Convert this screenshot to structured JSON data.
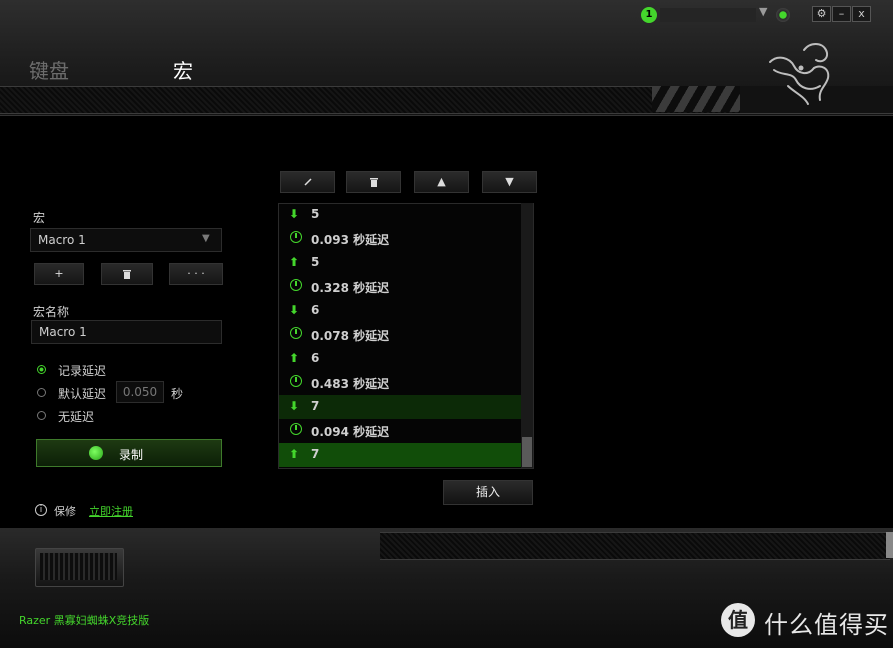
{
  "header": {
    "tabs": [
      {
        "label": "键盘"
      },
      {
        "label": "宏"
      }
    ],
    "user_badge": "1",
    "window_buttons": {
      "settings": "⚙",
      "minimize": "–",
      "close": "x"
    }
  },
  "left_panel": {
    "macro_label": "宏",
    "macro_select_value": "Macro 1",
    "buttons": {
      "add": "+",
      "delete": "🗑",
      "more": "· · ·"
    },
    "macro_name_label": "宏名称",
    "macro_name_value": "Macro 1",
    "delay_options": [
      {
        "label": "记录延迟",
        "selected": true
      },
      {
        "label": "默认延迟",
        "selected": false
      },
      {
        "label": "无延迟",
        "selected": false
      }
    ],
    "default_delay_value": "0.050",
    "default_delay_unit": "秒",
    "record_label": "录制",
    "hint_label": "保修",
    "register_link": "立即注册"
  },
  "right_panel": {
    "toolbar": {
      "edit": "✎",
      "delete": "🗑",
      "move_up": "▲",
      "move_down": "▼"
    },
    "events": [
      {
        "type": "keydown",
        "text": "5"
      },
      {
        "type": "delay",
        "text": "0.093 秒延迟"
      },
      {
        "type": "keyup",
        "text": "5"
      },
      {
        "type": "delay",
        "text": "0.328 秒延迟"
      },
      {
        "type": "keydown",
        "text": "6"
      },
      {
        "type": "delay",
        "text": "0.078 秒延迟"
      },
      {
        "type": "keyup",
        "text": "6"
      },
      {
        "type": "delay",
        "text": "0.483 秒延迟"
      },
      {
        "type": "keydown",
        "text": "7"
      },
      {
        "type": "delay",
        "text": "0.094 秒延迟"
      },
      {
        "type": "keyup",
        "text": "7"
      }
    ],
    "insert_label": "插入"
  },
  "footer": {
    "device_name": "Razer 黑寡妇蜘蛛X竞技版",
    "watermark_logo": "值",
    "watermark_text": "什么值得买"
  },
  "colors": {
    "accent": "#44d62c",
    "selected_row": "#114d09",
    "highlight_row": "#0c2a07"
  },
  "icons": [
    "razer-logo",
    "settings-icon",
    "sync-icon",
    "pencil-icon",
    "trash-icon",
    "arrow-up-icon",
    "arrow-down-icon",
    "clock-icon",
    "info-icon"
  ]
}
